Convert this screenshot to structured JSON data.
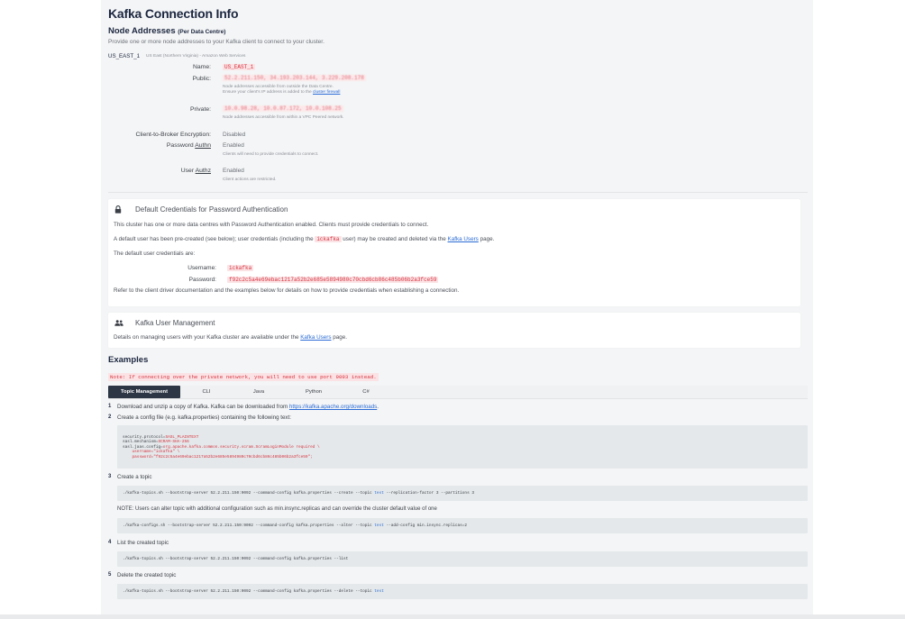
{
  "page_title": "Kafka Connection Info",
  "node_addresses": {
    "title": "Node Addresses",
    "title_suffix": "(Per Data Centre)",
    "description": "Provide one or more node addresses to your Kafka client to connect to your cluster.",
    "dc_id": "US_EAST_1",
    "dc_region": "US East (Northern Virginia) - Amazon Web Services",
    "name_label": "Name:",
    "name_value": "US_EAST_1",
    "public_label": "Public:",
    "public_value": "52.2.211.150, 34.193.203.144, 3.229.208.178",
    "public_hint1": "Node addresses accessible from outside the Data Centre.",
    "public_hint2_pre": "Ensure your client's IP address is added to the",
    "public_hint2_link": "cluster firewall",
    "private_label": "Private:",
    "private_value": "10.0.98.28, 10.0.87.172, 10.0.108.25",
    "private_hint": "Node addresses accessible from within a VPC Peered network.",
    "c2b_label": "Client-to-Broker Encryption:",
    "c2b_value": "Disabled",
    "pwd_label_pre": "Password",
    "pwd_label_link": "Authn",
    "pwd_value": "Enabled",
    "pwd_hint": "Clients will need to provide credentials to connect.",
    "user_label_pre": "User",
    "user_label_link": "Authz",
    "user_value": "Enabled",
    "user_hint": "Client actions are restricted."
  },
  "credentials": {
    "title": "Default Credentials for Password Authentication",
    "line1": "This cluster has one or more data centres with Password Authentication enabled. Clients must provide credentials to connect.",
    "line2_pre": "A default user has been pre-created (see below); user credentials (including the",
    "line2_code": "ickafka",
    "line2_mid": "user) may be created and deleted via the",
    "line2_link": "Kafka Users",
    "line2_post": "page.",
    "line3": "The default user credentials are:",
    "username_label": "Username:",
    "username_value": "ickafka",
    "password_label": "Password:",
    "password_value": "f92c2c5a4e69ebac1217a52b2e685e5894980c70cbd6cb86c485b06b2a3fce59",
    "line4": "Refer to the client driver documentation and the examples below for details on how to provide credentials when establishing a connection."
  },
  "user_mgmt": {
    "title": "Kafka User Management",
    "text_pre": "Details on managing users with your Kafka cluster are available under the",
    "text_link": "Kafka Users",
    "text_post": "page."
  },
  "examples": {
    "title": "Examples",
    "note": "Note: If connecting over the private network, you will need to use port 9093 instead.",
    "tabs": [
      "Topic Management",
      "CLI",
      "Java",
      "Python",
      "C#"
    ],
    "active_tab": "Topic Management",
    "step1_num": "1",
    "step1_pre": "Download and unzip a copy of Kafka. Kafka can be downloaded from",
    "step1_link": "https://kafka.apache.org/downloads",
    "step1_post": ".",
    "step2_num": "2",
    "step2": "Create a config file (e.g. kafka.properties) containing the following text:",
    "config_l1_key": "security.protocol=",
    "config_l1_val": "SASL_PLAINTEXT",
    "config_l2_key": "sasl.mechanism=",
    "config_l2_val": "SCRAM-SHA-256",
    "config_l3_key": "sasl.jaas.config=",
    "config_l3_val": "org.apache.kafka.common.security.scram.ScramLoginModule required \\",
    "config_l4": "    username=\"ickafka\" \\",
    "config_l5": "    password=\"f92c2c5a4e69ebac1217a52b2e685e5894980c70cbd6cb86c485b06b2a3fce59\";",
    "step3_num": "3",
    "step3": "Create a topic",
    "cmd_create_pre": "./kafka-topics.sh --bootstrap-server 52.2.211.150:9092 --command-config kafka.properties --create --topic",
    "cmd_create_topic": "test",
    "cmd_create_post": "--replication-factor 3 --partitions 3",
    "step3_note": "NOTE: Users can alter topic with additional configuration such as min.insync.replicas and can override the cluster default value of one",
    "cmd_alter_pre": "./kafka-configs.sh --bootstrap-server 52.2.211.150:9092 --command-config kafka.properties --alter --topic",
    "cmd_alter_topic": "test",
    "cmd_alter_post": "--add-config min.insync.replicas=2",
    "step4_num": "4",
    "step4": "List the created topic",
    "cmd_list": "./kafka-topics.sh --bootstrap-server 52.2.211.150:9092 --command-config kafka.properties --list",
    "step5_num": "5",
    "step5": "Delete the created topic",
    "cmd_delete_pre": "./kafka-topics.sh --bootstrap-server 52.2.211.150:9092 --command-config kafka.properties --delete --topic",
    "cmd_delete_topic": "test"
  }
}
